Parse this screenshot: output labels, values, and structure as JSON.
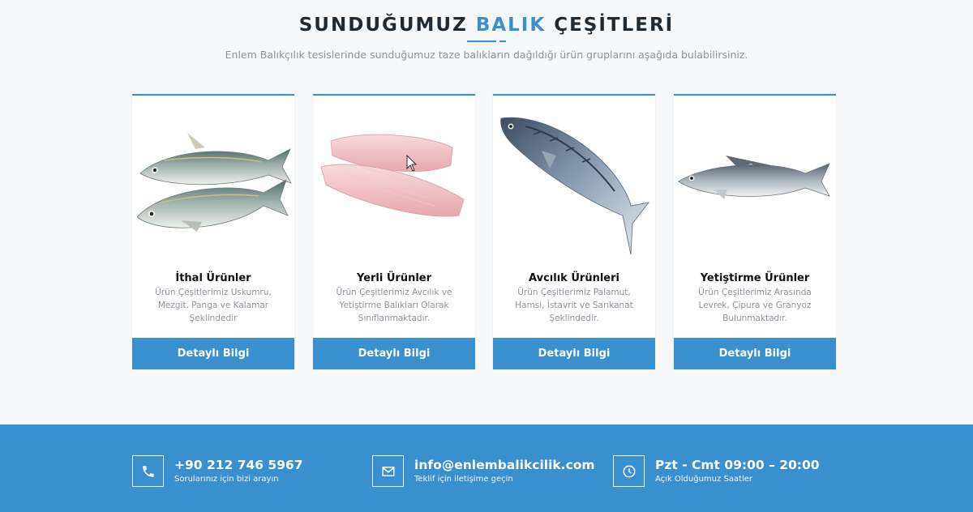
{
  "header": {
    "title_part1": "SUNDUĞUMUZ",
    "title_accent": "BALIK",
    "title_part2": "ÇEŞİTLERİ",
    "subtitle": "Enlem Balıkçılık tesislerinde sunduğumuz taze balıkların dağıldığı ürün gruplarını aşağıda bulabilirsiniz."
  },
  "cards": [
    {
      "name": "İthal Ürünler",
      "description": "Ürün Çeşitlerimiz Uskumru, Mezgit, Panga ve Kalamar Şeklindedir",
      "button": "Detaylı Bilgi",
      "image": "two-mackerel-image"
    },
    {
      "name": "Yerli Ürünler",
      "description": "Ürün Çeşitlerimiz Avcılık ve Yetiştirme Balıkları Olarak Sınıflanmaktadır.",
      "button": "Detaylı Bilgi",
      "image": "fish-fillet-image"
    },
    {
      "name": "Avcılık Ürünleri",
      "description": "Ürün Çeşitlerimiz Palamut, Hamsi, İstavrit ve Sarıkanat Şeklindedir.",
      "button": "Detaylı Bilgi",
      "image": "bonito-image"
    },
    {
      "name": "Yetiştirme Ürünler",
      "description": "Ürün Çeşitlerimiz Arasında Levrek, Çipura ve Granyoz Bulunmaktadır.",
      "button": "Detaylı Bilgi",
      "image": "sea-bass-image"
    }
  ],
  "footer": {
    "phone": {
      "value": "+90 212 746 5967",
      "caption": "Sorularınız için bizi arayın",
      "icon": "phone-icon"
    },
    "email": {
      "value": "info@enlembalikcilik.com",
      "caption": "Teklif için iletişime geçin",
      "icon": "envelope-icon"
    },
    "hours": {
      "value": "Pzt - Cmt 09:00 – 20:00",
      "caption": "Açık Olduğumuz Saatler",
      "icon": "clock-icon"
    }
  },
  "colors": {
    "accent": "#3a8fce",
    "title": "#1f2a33",
    "text_muted": "#8d959d"
  }
}
